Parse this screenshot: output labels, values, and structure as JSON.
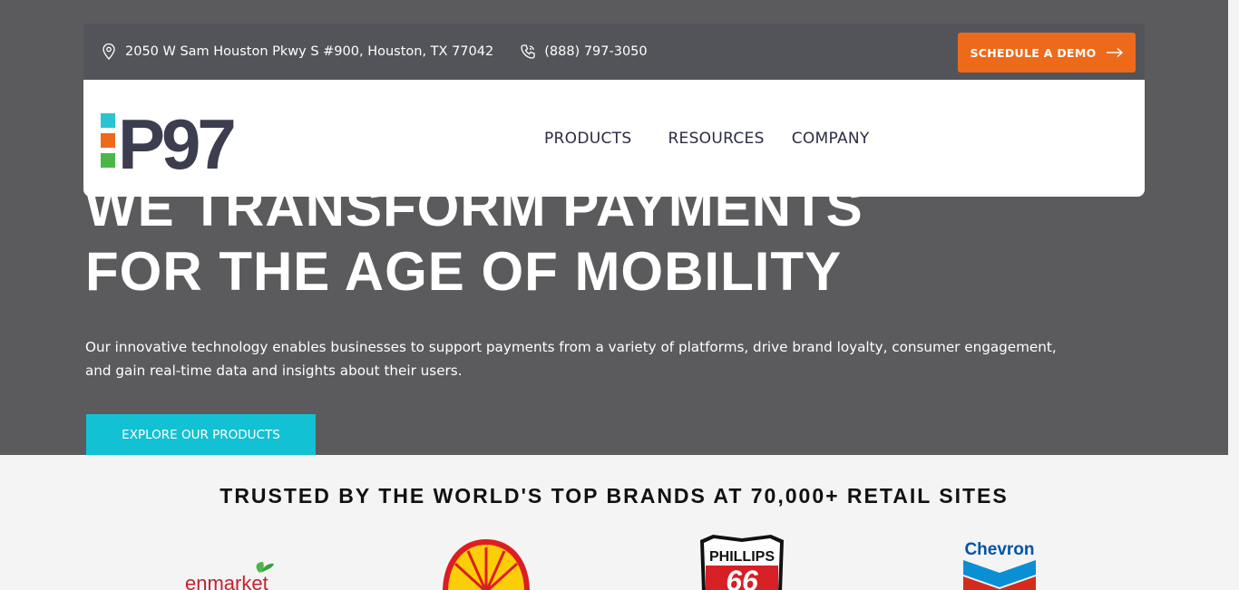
{
  "topbar": {
    "address": "2050 W Sam Houston Pkwy S #900, Houston, TX 77042",
    "phone": "(888) 797-3050",
    "demo_label": "SCHEDULE A DEMO"
  },
  "logo": {
    "text": "P97"
  },
  "nav": {
    "items": [
      "PRODUCTS",
      "RESOURCES",
      "COMPANY"
    ]
  },
  "hero": {
    "headline_lines": [
      "WE TRANSFORM PAYMENTS",
      "FOR THE AGE OF MOBILITY"
    ],
    "description": "Our innovative technology enables businesses to support payments from a variety of platforms, drive brand loyalty, consumer engagement, and gain real-time data and insights about their users.",
    "cta_label": "EXPLORE OUR PRODUCTS"
  },
  "trusted": {
    "title": "TRUSTED BY THE WORLD'S TOP BRANDS AT 70,000+ RETAIL SITES",
    "brands": [
      {
        "name": "enmarket",
        "text": "enmarket"
      },
      {
        "name": "shell",
        "text": ""
      },
      {
        "name": "phillips66",
        "text": "PHILLIPS",
        "number": "66"
      },
      {
        "name": "chevron",
        "text": "Chevron"
      }
    ]
  },
  "colors": {
    "hero_bg": "#5b5b5d",
    "topbar_bg": "#535459",
    "demo_button": "#ed6a1b",
    "explore_button": "#12c1d3",
    "logo_text": "#3d3d50",
    "logo_cyan": "#2bc4d3",
    "logo_orange": "#ed6a1b",
    "logo_green": "#4cb748"
  },
  "icons": {
    "address": "map-pin-icon",
    "phone": "phone-icon",
    "demo_arrow": "arrow-right-icon"
  }
}
